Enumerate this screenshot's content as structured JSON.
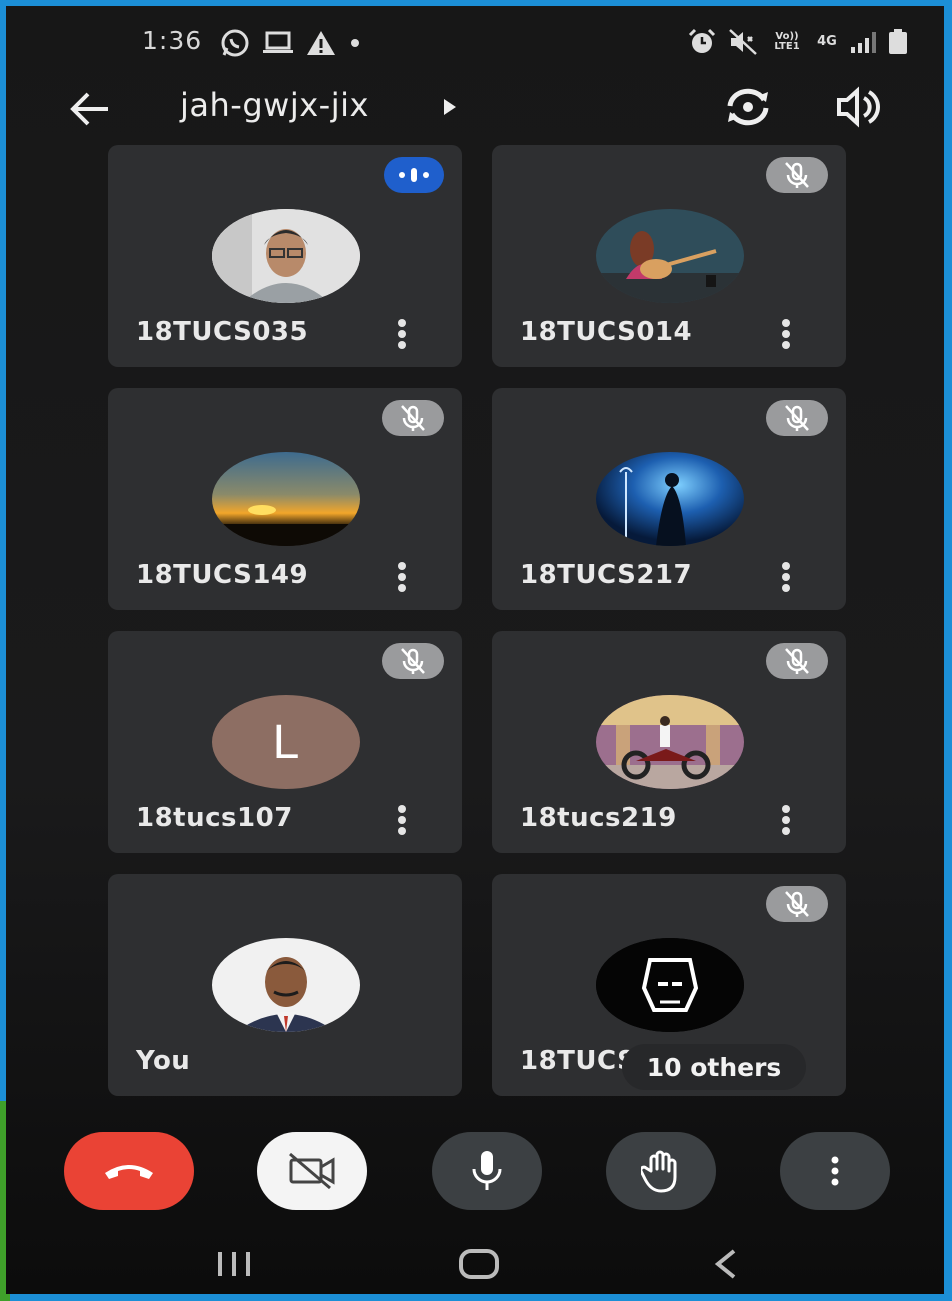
{
  "status_bar": {
    "time": "1:36",
    "left_icons": [
      "whatsapp-icon",
      "laptop-icon",
      "warning-icon",
      "dot-icon"
    ],
    "right_icons": [
      "alarm-icon",
      "mute-vibrate-icon",
      "volte-icon",
      "network-4g-icon",
      "signal-icon",
      "battery-icon"
    ],
    "volte_label": "Vo)) LTE1",
    "network_label": "4G"
  },
  "app_bar": {
    "meeting_code": "jah-gwjx-jix",
    "icons": [
      "back-arrow-icon",
      "caret-right-icon",
      "switch-camera-icon",
      "speaker-icon"
    ]
  },
  "participants": [
    {
      "name": "18TUCS035",
      "audio": "speaking",
      "avatar": "photo"
    },
    {
      "name": "18TUCS014",
      "audio": "muted",
      "avatar": "photo"
    },
    {
      "name": "18TUCS149",
      "audio": "muted",
      "avatar": "photo"
    },
    {
      "name": "18TUCS217",
      "audio": "muted",
      "avatar": "photo"
    },
    {
      "name": "18tucs107",
      "audio": "muted",
      "avatar": "initial",
      "initial": "L",
      "avatar_color": "#8d6e63"
    },
    {
      "name": "18tucs219",
      "audio": "muted",
      "avatar": "photo"
    },
    {
      "name": "You",
      "audio": "none",
      "avatar": "photo"
    },
    {
      "name": "18TUCS1",
      "audio": "muted",
      "avatar": "iron-man-icon",
      "overlay": "10 others"
    }
  ],
  "controls": {
    "buttons": [
      "end-call-button",
      "camera-off-button",
      "microphone-button",
      "raise-hand-button",
      "more-options-button"
    ],
    "end_call_color": "#ea4335"
  },
  "nav_bar": {
    "buttons": [
      "recent-apps-button",
      "home-button",
      "back-button"
    ]
  }
}
